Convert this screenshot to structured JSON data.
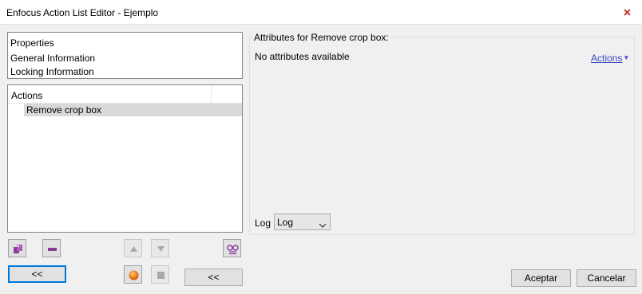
{
  "window": {
    "title": "Enfocus Action List Editor - Ejemplo"
  },
  "properties": {
    "header": "Properties",
    "items": [
      "General Information",
      "Locking Information"
    ]
  },
  "actions_list": {
    "header": "Actions",
    "items": [
      "Remove crop box"
    ]
  },
  "attributes": {
    "group_title": "Attributes for Remove crop box:",
    "empty_text": "No attributes available",
    "actions_link": "Actions",
    "log_label": "Log",
    "log_value": "Log"
  },
  "buttons": {
    "collapse_left": "<<",
    "collapse_middle": "<<",
    "accept": "Aceptar",
    "cancel": "Cancelar"
  },
  "toolbar_icons": [
    "add-action-icon",
    "remove-action-icon",
    "move-up-icon",
    "move-down-icon",
    "preview-glasses-icon",
    "record-icon",
    "stop-icon"
  ],
  "colors": {
    "accent": "#0078d7",
    "link": "#3b48c8",
    "selection": "#d9d9d9",
    "icon_purple": "#8b3a9b",
    "record_orange": "#f07800"
  }
}
